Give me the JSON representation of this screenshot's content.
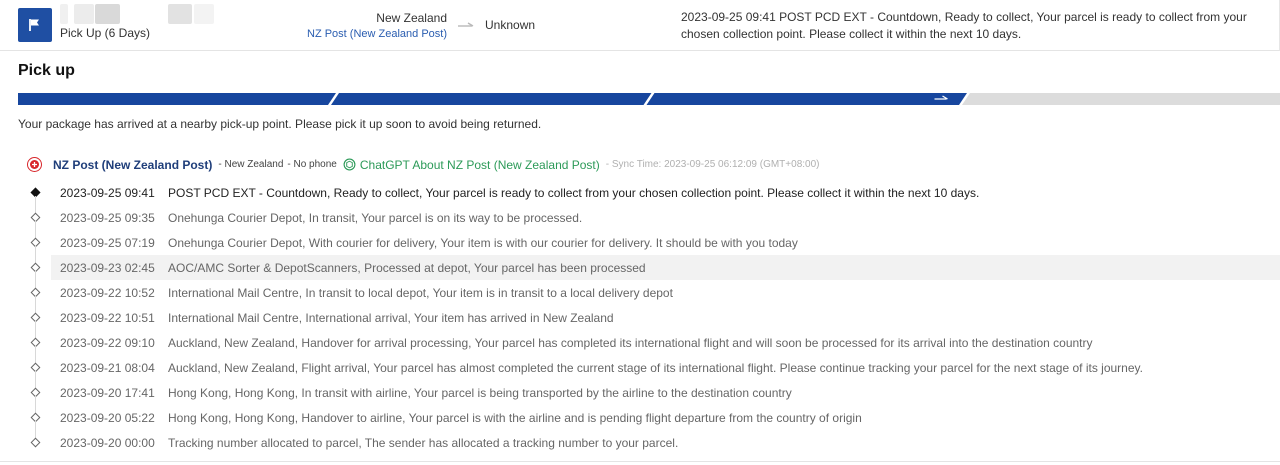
{
  "header": {
    "status_label": "Pick Up (6 Days)",
    "origin_country": "New Zealand",
    "origin_carrier": "NZ Post (New Zealand Post)",
    "destination": "Unknown",
    "latest_event": "2023-09-25 09:41  POST PCD EXT - Countdown, Ready to collect, Your parcel is ready to collect from your chosen collection point. Please collect it within the next 10 days."
  },
  "page": {
    "title": "Pick up",
    "hint": "Your package has arrived at a nearby pick-up point. Please pick it up soon to avoid being returned."
  },
  "progress": {
    "completed_steps": 3,
    "total_steps": 4,
    "active_color": "#17469e",
    "inactive_color": "#dcdcdc"
  },
  "carrier": {
    "name": "NZ Post (New Zealand Post)",
    "country": "- New Zealand",
    "phone": "- No phone",
    "ai_link": "ChatGPT About NZ Post (New Zealand Post)",
    "sync": "- Sync Time: 2023-09-25 06:12:09 (GMT+08:00)"
  },
  "events": [
    {
      "date": "2023-09-25 09:41",
      "text": "POST PCD EXT - Countdown, Ready to collect, Your parcel is ready to collect from your chosen collection point. Please collect it within the next 10 days."
    },
    {
      "date": "2023-09-25 09:35",
      "text": "Onehunga Courier Depot, In transit, Your parcel is on its way to be processed."
    },
    {
      "date": "2023-09-25 07:19",
      "text": "Onehunga Courier Depot, With courier for delivery, Your item is with our courier for delivery. It should be with you today"
    },
    {
      "date": "2023-09-23 02:45",
      "text": "AOC/AMC Sorter & DepotScanners, Processed at depot, Your parcel has been processed"
    },
    {
      "date": "2023-09-22 10:52",
      "text": "International Mail Centre, In transit to local depot, Your item is in transit to a local delivery depot"
    },
    {
      "date": "2023-09-22 10:51",
      "text": "International Mail Centre, International arrival, Your item has arrived in New Zealand"
    },
    {
      "date": "2023-09-22 09:10",
      "text": "Auckland, New Zealand, Handover for arrival processing, Your parcel has completed its international flight and will soon be processed for its arrival into the destination country"
    },
    {
      "date": "2023-09-21 08:04",
      "text": "Auckland, New Zealand, Flight arrival, Your parcel has almost completed the current stage of its international flight. Please continue tracking your parcel for the next stage of its journey."
    },
    {
      "date": "2023-09-20 17:41",
      "text": "Hong Kong, Hong Kong, In transit with airline, Your parcel is being transported by the airline to the destination country"
    },
    {
      "date": "2023-09-20 05:22",
      "text": "Hong Kong, Hong Kong, Handover to airline, Your parcel is with the airline and is pending flight departure from the country of origin"
    },
    {
      "date": "2023-09-20 00:00",
      "text": "Tracking number allocated to parcel, The sender has allocated a tracking number to your parcel."
    }
  ],
  "icons": {
    "status": "flag-icon",
    "route_arrow": "arrow-right-icon",
    "carrier_logo": "nz-post-logo-icon",
    "ai": "chatgpt-icon"
  },
  "colors": {
    "brand_blue": "#1f4fa3",
    "ai_green": "#2c9a58",
    "link_blue": "#2a5db0",
    "carrier_red": "#d8262b"
  }
}
